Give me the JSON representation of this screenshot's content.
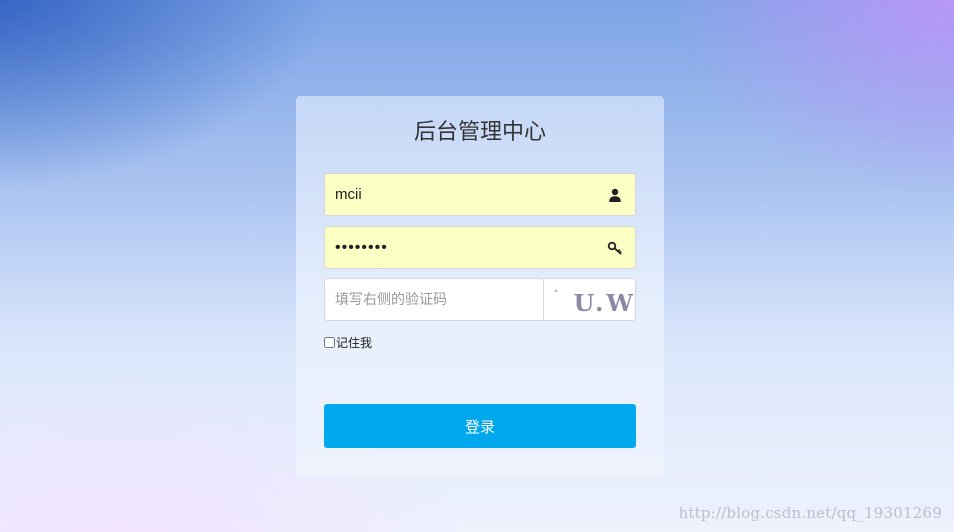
{
  "login": {
    "title": "后台管理中心",
    "username_value": "mcii",
    "password_value": "mciimcii",
    "captcha_placeholder": "填写右侧的验证码",
    "captcha_text": "U.Wc",
    "remember_label": "记住我",
    "remember_checked": false,
    "submit_label": "登录"
  },
  "icons": {
    "username": "user-icon",
    "password": "key-icon"
  },
  "colors": {
    "button": "#00a9ee",
    "autofill": "#fbffc4"
  },
  "watermark": "http://blog.csdn.net/qq_19301269"
}
